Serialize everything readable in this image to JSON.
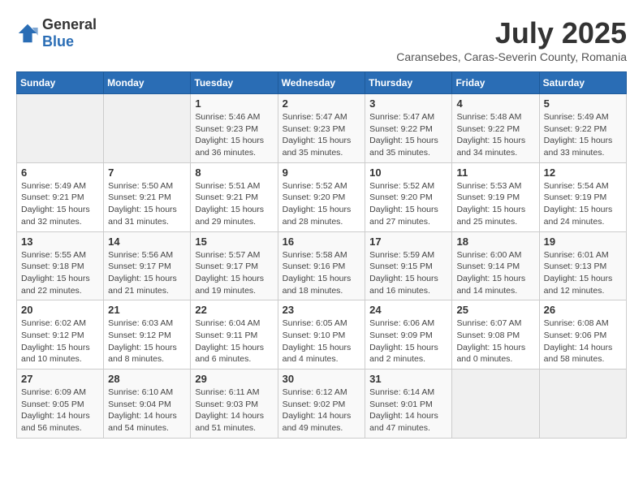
{
  "header": {
    "logo_general": "General",
    "logo_blue": "Blue",
    "month_title": "July 2025",
    "subtitle": "Caransebes, Caras-Severin County, Romania"
  },
  "weekdays": [
    "Sunday",
    "Monday",
    "Tuesday",
    "Wednesday",
    "Thursday",
    "Friday",
    "Saturday"
  ],
  "weeks": [
    [
      {
        "day": "",
        "info": ""
      },
      {
        "day": "",
        "info": ""
      },
      {
        "day": "1",
        "info": "Sunrise: 5:46 AM\nSunset: 9:23 PM\nDaylight: 15 hours and 36 minutes."
      },
      {
        "day": "2",
        "info": "Sunrise: 5:47 AM\nSunset: 9:23 PM\nDaylight: 15 hours and 35 minutes."
      },
      {
        "day": "3",
        "info": "Sunrise: 5:47 AM\nSunset: 9:22 PM\nDaylight: 15 hours and 35 minutes."
      },
      {
        "day": "4",
        "info": "Sunrise: 5:48 AM\nSunset: 9:22 PM\nDaylight: 15 hours and 34 minutes."
      },
      {
        "day": "5",
        "info": "Sunrise: 5:49 AM\nSunset: 9:22 PM\nDaylight: 15 hours and 33 minutes."
      }
    ],
    [
      {
        "day": "6",
        "info": "Sunrise: 5:49 AM\nSunset: 9:21 PM\nDaylight: 15 hours and 32 minutes."
      },
      {
        "day": "7",
        "info": "Sunrise: 5:50 AM\nSunset: 9:21 PM\nDaylight: 15 hours and 31 minutes."
      },
      {
        "day": "8",
        "info": "Sunrise: 5:51 AM\nSunset: 9:21 PM\nDaylight: 15 hours and 29 minutes."
      },
      {
        "day": "9",
        "info": "Sunrise: 5:52 AM\nSunset: 9:20 PM\nDaylight: 15 hours and 28 minutes."
      },
      {
        "day": "10",
        "info": "Sunrise: 5:52 AM\nSunset: 9:20 PM\nDaylight: 15 hours and 27 minutes."
      },
      {
        "day": "11",
        "info": "Sunrise: 5:53 AM\nSunset: 9:19 PM\nDaylight: 15 hours and 25 minutes."
      },
      {
        "day": "12",
        "info": "Sunrise: 5:54 AM\nSunset: 9:19 PM\nDaylight: 15 hours and 24 minutes."
      }
    ],
    [
      {
        "day": "13",
        "info": "Sunrise: 5:55 AM\nSunset: 9:18 PM\nDaylight: 15 hours and 22 minutes."
      },
      {
        "day": "14",
        "info": "Sunrise: 5:56 AM\nSunset: 9:17 PM\nDaylight: 15 hours and 21 minutes."
      },
      {
        "day": "15",
        "info": "Sunrise: 5:57 AM\nSunset: 9:17 PM\nDaylight: 15 hours and 19 minutes."
      },
      {
        "day": "16",
        "info": "Sunrise: 5:58 AM\nSunset: 9:16 PM\nDaylight: 15 hours and 18 minutes."
      },
      {
        "day": "17",
        "info": "Sunrise: 5:59 AM\nSunset: 9:15 PM\nDaylight: 15 hours and 16 minutes."
      },
      {
        "day": "18",
        "info": "Sunrise: 6:00 AM\nSunset: 9:14 PM\nDaylight: 15 hours and 14 minutes."
      },
      {
        "day": "19",
        "info": "Sunrise: 6:01 AM\nSunset: 9:13 PM\nDaylight: 15 hours and 12 minutes."
      }
    ],
    [
      {
        "day": "20",
        "info": "Sunrise: 6:02 AM\nSunset: 9:12 PM\nDaylight: 15 hours and 10 minutes."
      },
      {
        "day": "21",
        "info": "Sunrise: 6:03 AM\nSunset: 9:12 PM\nDaylight: 15 hours and 8 minutes."
      },
      {
        "day": "22",
        "info": "Sunrise: 6:04 AM\nSunset: 9:11 PM\nDaylight: 15 hours and 6 minutes."
      },
      {
        "day": "23",
        "info": "Sunrise: 6:05 AM\nSunset: 9:10 PM\nDaylight: 15 hours and 4 minutes."
      },
      {
        "day": "24",
        "info": "Sunrise: 6:06 AM\nSunset: 9:09 PM\nDaylight: 15 hours and 2 minutes."
      },
      {
        "day": "25",
        "info": "Sunrise: 6:07 AM\nSunset: 9:08 PM\nDaylight: 15 hours and 0 minutes."
      },
      {
        "day": "26",
        "info": "Sunrise: 6:08 AM\nSunset: 9:06 PM\nDaylight: 14 hours and 58 minutes."
      }
    ],
    [
      {
        "day": "27",
        "info": "Sunrise: 6:09 AM\nSunset: 9:05 PM\nDaylight: 14 hours and 56 minutes."
      },
      {
        "day": "28",
        "info": "Sunrise: 6:10 AM\nSunset: 9:04 PM\nDaylight: 14 hours and 54 minutes."
      },
      {
        "day": "29",
        "info": "Sunrise: 6:11 AM\nSunset: 9:03 PM\nDaylight: 14 hours and 51 minutes."
      },
      {
        "day": "30",
        "info": "Sunrise: 6:12 AM\nSunset: 9:02 PM\nDaylight: 14 hours and 49 minutes."
      },
      {
        "day": "31",
        "info": "Sunrise: 6:14 AM\nSunset: 9:01 PM\nDaylight: 14 hours and 47 minutes."
      },
      {
        "day": "",
        "info": ""
      },
      {
        "day": "",
        "info": ""
      }
    ]
  ]
}
